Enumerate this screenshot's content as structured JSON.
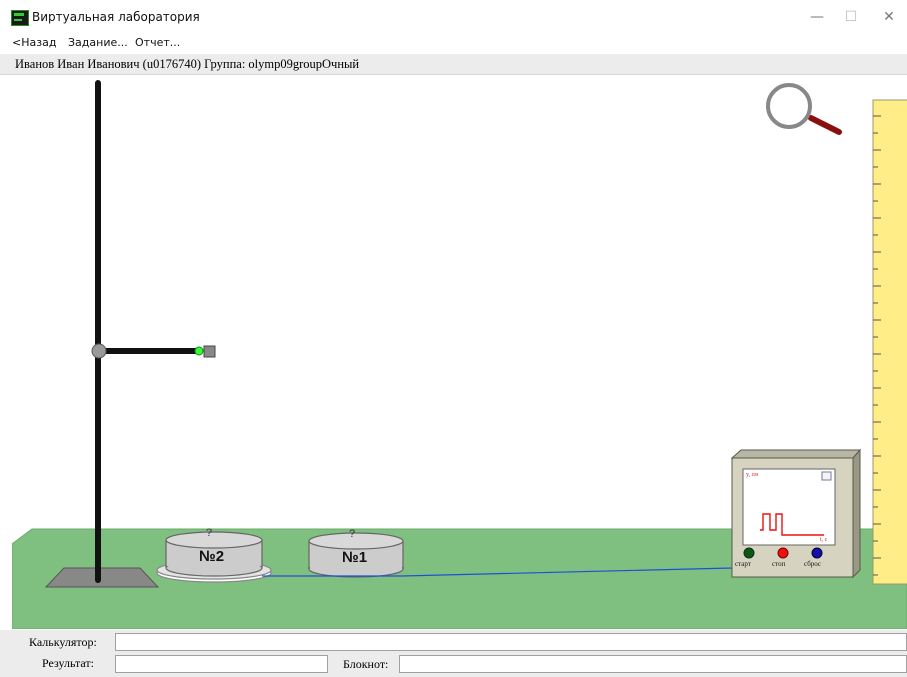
{
  "window": {
    "title": "Виртуальная лаборатория",
    "minimize": "—",
    "maximize": "☐",
    "close": "✕"
  },
  "menu": {
    "back": "<Назад",
    "task": "Задание...",
    "report": "Отчет..."
  },
  "user": {
    "info": "Иванов Иван Иванович (u0176740)  Группа: olymp09groupОчный"
  },
  "lab": {
    "cylinder2": {
      "label": "№2",
      "mark": "?"
    },
    "cylinder1": {
      "label": "№1",
      "mark": "?"
    },
    "oscilloscope": {
      "axis_y": "y, см",
      "axis_t": "t, с",
      "start_label": "старт",
      "stop_label": "стоп",
      "reset_label": "сброс"
    },
    "colors": {
      "ground": "#7fbf7f",
      "ruler": "#ffee88",
      "wire": "#1f4fd8",
      "start_button": "#115511",
      "stop_button": "#ee1111",
      "reset_button": "#1111aa",
      "trace": "#ee1111"
    }
  },
  "bottom": {
    "calculator_label": "Калькулятор:",
    "calculator_value": "",
    "result_label": "Результат:",
    "result_value": "",
    "notepad_label": "Блокнот:",
    "notepad_value": ""
  }
}
